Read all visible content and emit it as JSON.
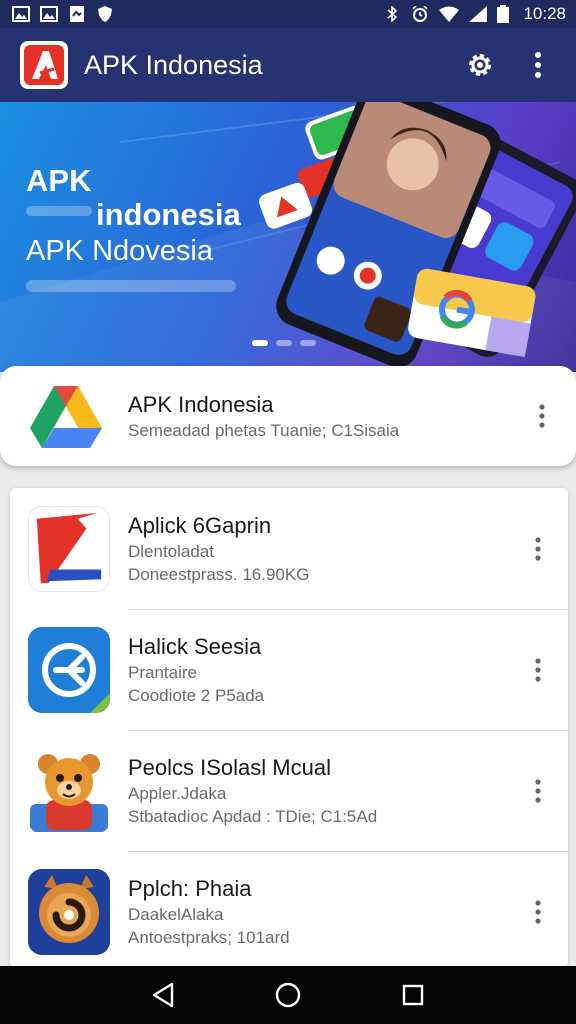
{
  "status_bar": {
    "time": "10:28",
    "left_icons": [
      "image-icon",
      "image-icon",
      "file-icon",
      "shield-icon"
    ],
    "right_icons": [
      "bluetooth-icon",
      "alarm-icon",
      "wifi-icon",
      "signal-icon",
      "battery-icon"
    ]
  },
  "app_bar": {
    "title": "APK Indonesia",
    "actions": [
      "gear-icon",
      "overflow-menu-icon"
    ]
  },
  "banner": {
    "line1": "APK",
    "line2": "indonesia",
    "line3": "APK Ndovesia",
    "slides": 3,
    "active_slide": 1
  },
  "featured": {
    "title": "APK Indonesia",
    "subtitle": "Semeadad phetas Tuanie; C1Sisaia"
  },
  "apps": [
    {
      "title": "Aplick 6Gaprin",
      "line1": "Dlentoladat",
      "line2": "Doneestprass. 16.90KG"
    },
    {
      "title": "Halick Seesia",
      "line1": "Prantaire",
      "line2": "Coodiote 2 P5ada"
    },
    {
      "title": "Peolcs ISolasl Mcual",
      "line1": "Appler.Jdaka",
      "line2": "Stbatadioc Apdad : TDie; C1:5Ad"
    },
    {
      "title": "Pplch: Phaia",
      "line1": "DaakelAlaka",
      "line2": "Antoestpraks; 101ard"
    }
  ],
  "nav": [
    "back-icon",
    "home-icon",
    "recents-icon"
  ],
  "colors": {
    "status_bar": "#1f2a5e",
    "app_bar": "#263272",
    "accent_red": "#e53228",
    "nav_bar": "#050505"
  }
}
